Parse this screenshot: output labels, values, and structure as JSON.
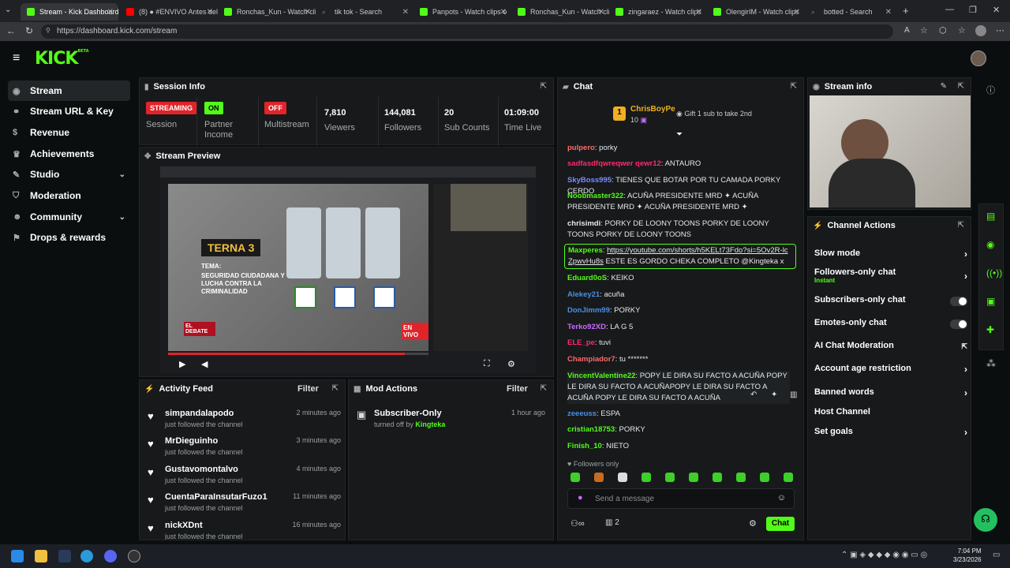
{
  "browser": {
    "tabs": [
      {
        "label": "Stream - Kick Dashboard",
        "color": "#53fc18",
        "active": true
      },
      {
        "label": "(8) ● #ENVIVO Antes del",
        "color": "#ff0000"
      },
      {
        "label": "Ronchas_Kun - Watch cli",
        "color": "#53fc18"
      },
      {
        "label": "tik tok - Search",
        "color": "#4a90e2"
      },
      {
        "label": "Panpots - Watch clips o",
        "color": "#53fc18"
      },
      {
        "label": "Ronchas_Kun - Watch cli",
        "color": "#53fc18"
      },
      {
        "label": "zingaraez - Watch clips",
        "color": "#53fc18"
      },
      {
        "label": "OlengirIM - Watch clips",
        "color": "#53fc18"
      },
      {
        "label": "botted - Search",
        "color": "#4a90e2"
      }
    ],
    "url": "https://dashboard.kick.com/stream"
  },
  "kick": {
    "logo": "KICK",
    "beta": "BETA"
  },
  "sidebar": {
    "items": [
      {
        "label": "Stream",
        "icon": "signal-icon"
      },
      {
        "label": "Stream URL & Key",
        "icon": "link-icon"
      },
      {
        "label": "Revenue",
        "icon": "dollar-icon"
      },
      {
        "label": "Achievements",
        "icon": "trophy-icon"
      },
      {
        "label": "Studio",
        "icon": "studio-icon"
      },
      {
        "label": "Moderation",
        "icon": "shield-icon"
      },
      {
        "label": "Community",
        "icon": "people-icon"
      },
      {
        "label": "Drops & rewards",
        "icon": "gift-icon"
      }
    ]
  },
  "session": {
    "title": "Session Info",
    "streaming_badge": "STREAMING",
    "session_label": "Session",
    "partner_badge": "ON",
    "partner_label": "Partner Income",
    "multi_badge": "OFF",
    "multi_label": "Multistream",
    "viewers": "7,810",
    "viewers_label": "Viewers",
    "followers": "144,081",
    "followers_label": "Followers",
    "subs": "20",
    "subs_label": "Sub Counts",
    "time": "01:09:00",
    "time_label": "Time Live"
  },
  "preview": {
    "title": "Stream Preview",
    "terna": "TERNA 3",
    "tema": "TEMA:",
    "topic": "SEGURIDAD CIUDADANA Y LUCHA CONTRA LA CRIMINALIDAD",
    "envivo": "EN VIVO",
    "debate": "EL DEBATE"
  },
  "activity": {
    "title": "Activity Feed",
    "filter": "Filter",
    "items": [
      {
        "name": "simpandalapodo",
        "sub": "just followed the channel",
        "time": "2 minutes ago"
      },
      {
        "name": "MrDieguinho",
        "sub": "just followed the channel",
        "time": "3 minutes ago"
      },
      {
        "name": "Gustavomontalvo",
        "sub": "just followed the channel",
        "time": "4 minutes ago"
      },
      {
        "name": "CuentaParaInsutarFuzo1",
        "sub": "just followed the channel",
        "time": "11 minutes ago"
      },
      {
        "name": "nickXDnt",
        "sub": "just followed the channel",
        "time": "16 minutes ago"
      }
    ]
  },
  "mod": {
    "title": "Mod Actions",
    "filter": "Filter",
    "action": "Subscriber-Only",
    "sub_prefix": "turned off by",
    "by": "Kingteka",
    "time": "1 hour ago"
  },
  "chat": {
    "title": "Chat",
    "pinned_user": "ChrisBoyPe",
    "pinned_rank": "1",
    "pinned_count": "10",
    "gift_text": "Gift 1 sub to take 2nd",
    "messages": [
      {
        "user": "pulpero",
        "color": "#ff6a6a",
        "text": "porky"
      },
      {
        "user": "sadfasdfqwreqwer qewr12",
        "color": "#ff2a6a",
        "text": "ANTAURO"
      },
      {
        "user": "SkyBoss995",
        "color": "#7a8cff",
        "text": "TIENES QUE BOTAR POR TU CAMADA PORKY CERDO"
      },
      {
        "user": "Noobmaster322",
        "color": "#53fc18",
        "text": "ACUÑA PRESIDENTE MRD ✦ ACUÑA PRESIDENTE MRD ✦ ACUÑA PRESIDENTE MRD ✦"
      },
      {
        "user": "chrisimdi",
        "color": "#e6e8e8",
        "text": "PORKY DE LOONY TOONS PORKY DE LOONY TOONS PORKY DE LOONY TOONS"
      },
      {
        "user": "Maxperes",
        "color": "#53fc18",
        "link": "https://youtube.com/shorts/h5KELt73Fdo?si=5Ov2R-lcZpwvHu8s",
        "text": "ESTE ES GORDO CHEKA COMPLETO @Kingteka x"
      },
      {
        "user": "Eduard0oS",
        "color": "#53fc18",
        "text": "KEIKO"
      },
      {
        "user": "Alekey21",
        "color": "#4a90e2",
        "text": "acuña"
      },
      {
        "user": "DonJimm99",
        "color": "#4a90e2",
        "text": "PORKY"
      },
      {
        "user": "Terko92XD",
        "color": "#c86cff",
        "text": "LA G 5"
      },
      {
        "user": "ELE_pe",
        "color": "#ff2a6a",
        "text": "tuvi"
      },
      {
        "user": "Champiador7",
        "color": "#ff6a6a",
        "text": "tu *******"
      },
      {
        "user": "VincentValentine22",
        "color": "#53fc18",
        "text": "POPY LE DIRA SU FACTO A ACUÑA POPY LE DIRA SU FACTO A ACUÑAPOPY LE DIRA SU FACTO A ACUÑA POPY LE DIRA SU FACTO A ACUÑA"
      },
      {
        "user": "zeeeuss",
        "color": "#4a90e2",
        "text": "ESPA"
      },
      {
        "user": "cristian18753",
        "color": "#53fc18",
        "text": "PORKY"
      },
      {
        "user": "Finish_10",
        "color": "#53fc18",
        "text": "NIETO"
      }
    ],
    "followers_only": "Followers only",
    "placeholder": "Send a message",
    "count": "2",
    "send": "Chat"
  },
  "stream_info": {
    "title": "Stream info"
  },
  "channel_actions": {
    "title": "Channel Actions",
    "items": [
      {
        "label": "Slow mode",
        "kind": "arrow"
      },
      {
        "label": "Followers-only chat",
        "sub": "Instant",
        "kind": "arrow"
      },
      {
        "label": "Subscribers-only chat",
        "kind": "toggle"
      },
      {
        "label": "Emotes-only chat",
        "kind": "toggle"
      },
      {
        "label": "AI Chat Moderation",
        "kind": "ext"
      },
      {
        "label": "Account age restriction",
        "kind": "arrow"
      },
      {
        "label": "Banned words",
        "kind": "arrow"
      },
      {
        "label": "Host Channel",
        "kind": "none"
      },
      {
        "label": "Set goals",
        "kind": "arrow"
      }
    ]
  },
  "taskbar": {
    "time": "7:04 PM",
    "date": "3/23/2026"
  }
}
